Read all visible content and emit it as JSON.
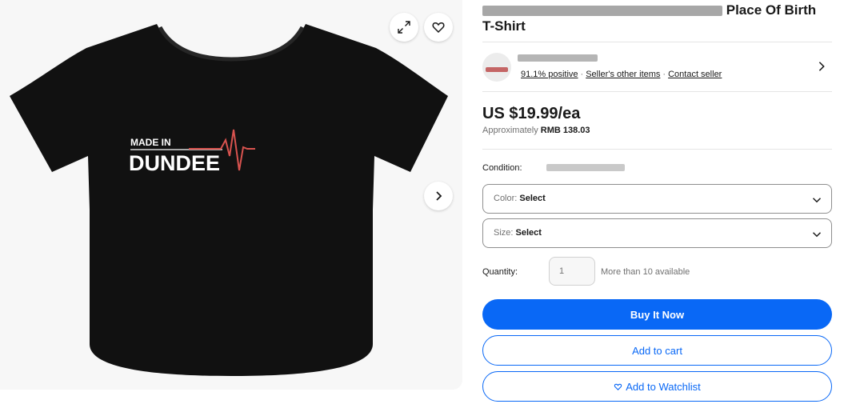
{
  "listing": {
    "title_line1_visible": "Place Of Birth",
    "title_line2": "T-Shirt",
    "shirt_print": {
      "line1": "MADE IN",
      "line2": "DUNDEE"
    }
  },
  "seller": {
    "positive": "91.1% positive",
    "separator": "·",
    "other_items": "Seller's other items",
    "contact": "Contact seller"
  },
  "pricing": {
    "price": "US $19.99/ea",
    "approx_prefix": "Approximately",
    "approx_value": "RMB 138.03"
  },
  "condition": {
    "label": "Condition:"
  },
  "options": {
    "color_label": "Color:",
    "color_value": "Select",
    "size_label": "Size:",
    "size_value": "Select"
  },
  "quantity": {
    "label": "Quantity:",
    "placeholder": "1",
    "available": "More than 10 available"
  },
  "actions": {
    "buy_now": "Buy It Now",
    "add_to_cart": "Add to cart",
    "add_to_watchlist": "Add to Watchlist"
  },
  "icons": {
    "expand": "expand-icon",
    "heart": "heart-icon",
    "next": "chevron-right-icon",
    "dropdown": "chevron-down-icon"
  },
  "colors": {
    "accent": "#0968f6",
    "shirt": "#111111",
    "pulse": "#d9534f"
  }
}
